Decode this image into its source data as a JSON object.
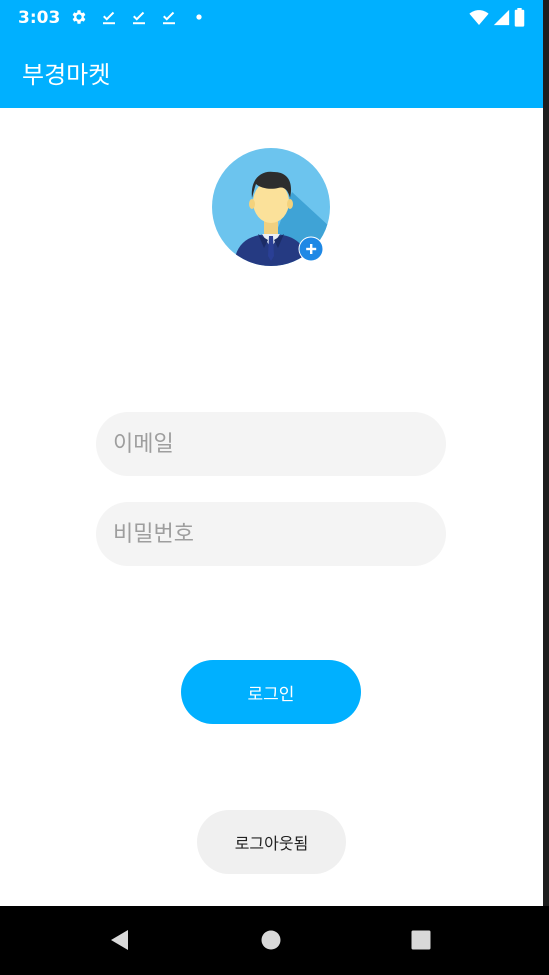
{
  "status_bar": {
    "time": "3:03",
    "left_icons": [
      "settings-icon",
      "download-done-icon",
      "download-done-icon",
      "download-done-icon",
      "dot-icon"
    ],
    "right_icons": [
      "wifi-icon",
      "signal-icon",
      "battery-icon"
    ]
  },
  "app_bar": {
    "title": "부경마켓"
  },
  "avatar": {
    "icon": "profile-avatar-icon",
    "badge_icon": "add-icon"
  },
  "form": {
    "email_placeholder": "이메일",
    "email_value": "",
    "password_placeholder": "비밀번호",
    "password_value": ""
  },
  "buttons": {
    "login_label": "로그인",
    "logout_label": "로그아웃됨"
  },
  "nav_bar": {
    "back_icon": "back-triangle-icon",
    "home_icon": "home-circle-icon",
    "recents_icon": "recents-square-icon"
  },
  "colors": {
    "accent": "#00b0ff",
    "input_bg": "#f4f4f4",
    "logout_bg": "#f0f0f0",
    "nav_bg": "#000000"
  }
}
